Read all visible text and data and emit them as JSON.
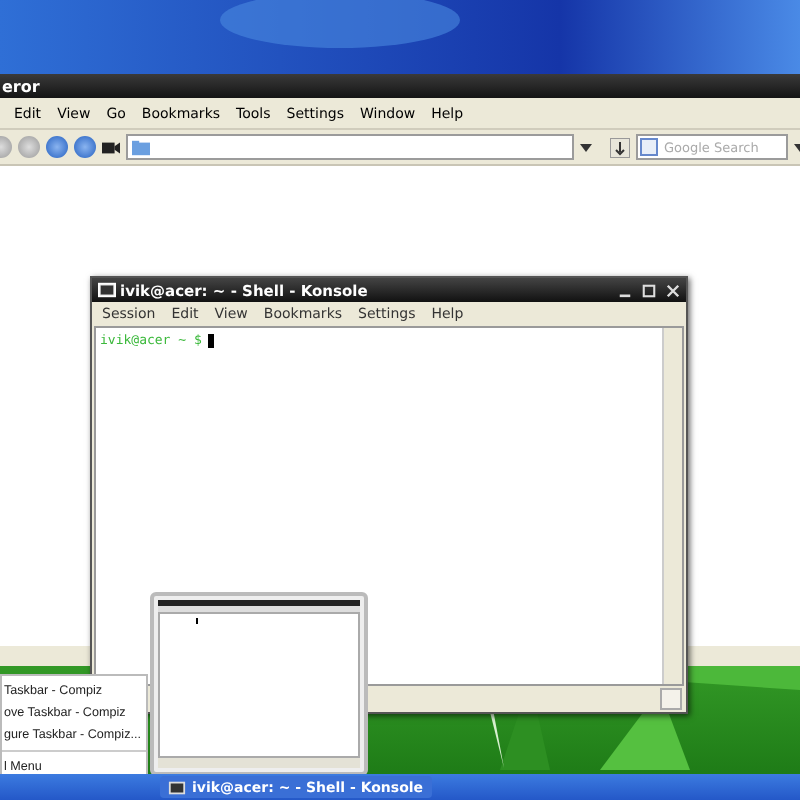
{
  "browser": {
    "title": "eror",
    "menu": [
      "Edit",
      "View",
      "Go",
      "Bookmarks",
      "Tools",
      "Settings",
      "Window",
      "Help"
    ],
    "search": {
      "placeholder": "Google Search"
    }
  },
  "konsole": {
    "title": "ivik@acer: ~ - Shell - Konsole",
    "menu": [
      "Session",
      "Edit",
      "View",
      "Bookmarks",
      "Settings",
      "Help"
    ],
    "prompt": "ivik@acer ~ $"
  },
  "context_menu": {
    "items": [
      {
        "kind": "entry",
        "label": "Taskbar - Compiz"
      },
      {
        "kind": "entry",
        "label": "ove Taskbar - Compiz"
      },
      {
        "kind": "entry",
        "label": "gure Taskbar - Compiz..."
      },
      {
        "kind": "separator"
      },
      {
        "kind": "entry",
        "label": "l Menu"
      }
    ]
  },
  "taskbar": {
    "tasks": [
      {
        "label": "ivik@acer: ~ - Shell - Konsole"
      }
    ]
  }
}
